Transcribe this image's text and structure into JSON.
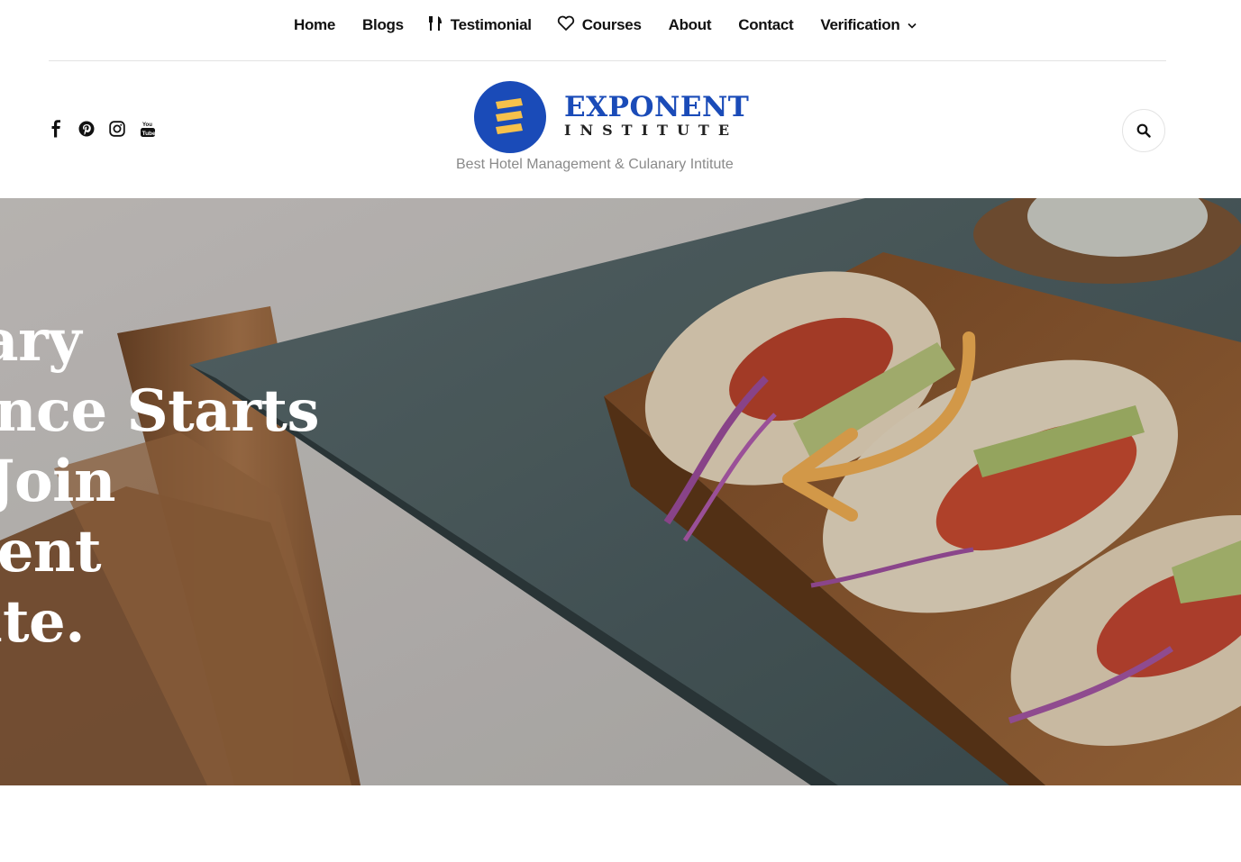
{
  "nav": {
    "items": [
      {
        "label": "Home",
        "icon": ""
      },
      {
        "label": "Blogs",
        "icon": ""
      },
      {
        "label": "Testimonial",
        "icon": "fork-knife-icon"
      },
      {
        "label": "Courses",
        "icon": "heart-icon"
      },
      {
        "label": "About",
        "icon": ""
      },
      {
        "label": "Contact",
        "icon": ""
      },
      {
        "label": "Verification",
        "icon": "chevron-down-icon"
      }
    ]
  },
  "header": {
    "logo_title": "EXPONENT",
    "logo_subtitle": "INSTITUTE",
    "tagline": "Best Hotel Management & Culanary Intitute",
    "social": [
      "facebook-icon",
      "pinterest-icon",
      "instagram-icon",
      "youtube-icon"
    ],
    "search_icon": "search-icon"
  },
  "hero": {
    "lines": [
      "ary",
      "ence Starts",
      "Join",
      "ent",
      "ute."
    ]
  },
  "colors": {
    "brand_blue": "#1a4bb8",
    "logo_yellow": "#f6c14b",
    "arrow_orange": "#f0ad52",
    "table_slate": "#4f6162",
    "wood": "#8a5a34"
  }
}
